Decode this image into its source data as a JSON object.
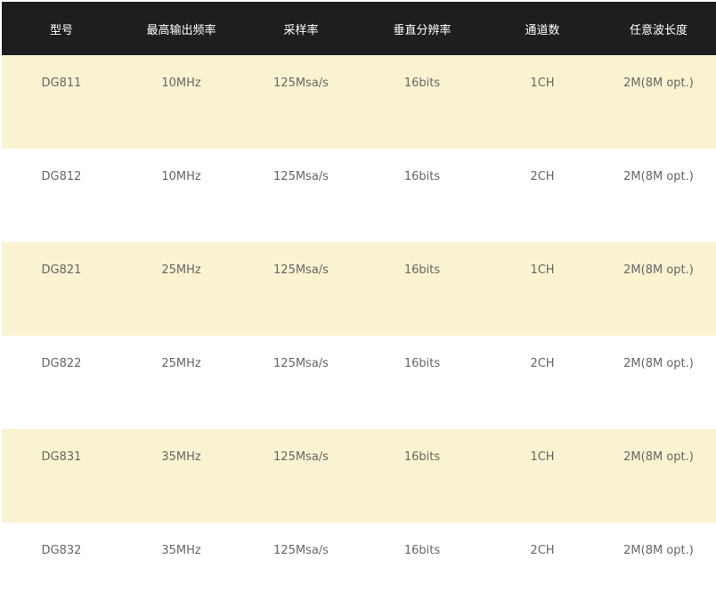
{
  "table": {
    "headers": [
      "型号",
      "最高输出频率",
      "采样率",
      "垂直分辨率",
      "通道数",
      "任意波长度"
    ],
    "rows": [
      [
        "DG811",
        "10MHz",
        "125Msa/s",
        "16bits",
        "1CH",
        "2M(8M opt.)"
      ],
      [
        "DG812",
        "10MHz",
        "125Msa/s",
        "16bits",
        "2CH",
        "2M(8M opt.)"
      ],
      [
        "DG821",
        "25MHz",
        "125Msa/s",
        "16bits",
        "1CH",
        "2M(8M opt.)"
      ],
      [
        "DG822",
        "25MHz",
        "125Msa/s",
        "16bits",
        "2CH",
        "2M(8M opt.)"
      ],
      [
        "DG831",
        "35MHz",
        "125Msa/s",
        "16bits",
        "1CH",
        "2M(8M opt.)"
      ],
      [
        "DG832",
        "35MHz",
        "125Msa/s",
        "16bits",
        "2CH",
        "2M(8M opt.)"
      ]
    ]
  },
  "colors": {
    "header_bg": "#1d1e20",
    "header_text": "#ffffff",
    "row_alt_bg": "#faf3d1",
    "row_bg": "#ffffff",
    "cell_text": "#666666"
  }
}
